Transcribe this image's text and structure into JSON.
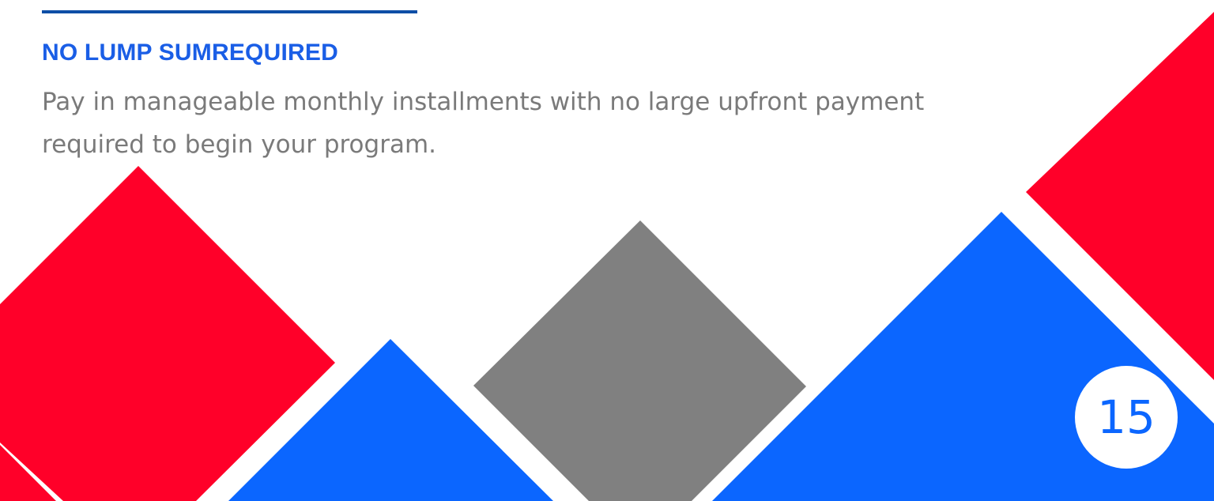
{
  "slide": {
    "heading": "NO LUMP SUMREQUIRED",
    "body": "Pay in manageable monthly installments with no large upfront payment required to begin your program.",
    "page_number": "15"
  },
  "colors": {
    "rule": "#0d4ea6",
    "heading": "#1a5ee6",
    "body_text": "#7a7a7a",
    "red": "#ff0029",
    "blue": "#0b66ff",
    "gray": "#808080"
  }
}
